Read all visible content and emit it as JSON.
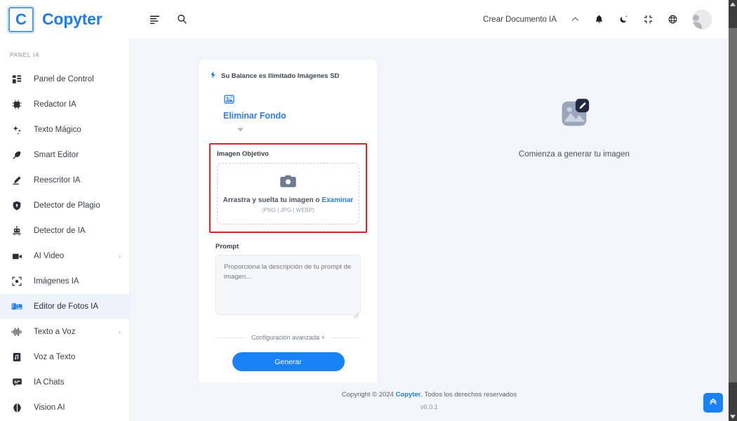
{
  "header": {
    "logo_letter": "C",
    "brand": "Copyter",
    "menu_icon": "menu-icon",
    "search_icon": "search-icon",
    "create_doc_label": "Crear Documento IA",
    "chevron_icon": "chevron-up-icon",
    "bell_icon": "bell-icon",
    "theme_icon": "moon-icon",
    "fullscreen_icon": "compress-icon",
    "language_icon": "globe-icon",
    "avatar_icon": "user-avatar"
  },
  "sidebar": {
    "section_title": "PANEL IA",
    "items": [
      {
        "label": "Panel de Control",
        "icon": "dashboard-icon",
        "active": false,
        "expandable": false
      },
      {
        "label": "Redactor IA",
        "icon": "chip-icon",
        "active": false,
        "expandable": false
      },
      {
        "label": "Texto Mágico",
        "icon": "sparkles-icon",
        "active": false,
        "expandable": false
      },
      {
        "label": "Smart Editor",
        "icon": "feather-icon",
        "active": false,
        "expandable": false
      },
      {
        "label": "Reescritor IA",
        "icon": "pencil-icon",
        "active": false,
        "expandable": false
      },
      {
        "label": "Detector de Plagio",
        "icon": "shield-icon",
        "active": false,
        "expandable": false
      },
      {
        "label": "Detector de IA",
        "icon": "robot-icon",
        "active": false,
        "expandable": false
      },
      {
        "label": "AI Video",
        "icon": "video-icon",
        "active": false,
        "expandable": true
      },
      {
        "label": "Imágenes IA",
        "icon": "image-frame-icon",
        "active": false,
        "expandable": false
      },
      {
        "label": "Editor de Fotos IA",
        "icon": "photo-edit-icon",
        "active": true,
        "expandable": false
      },
      {
        "label": "Texto a Voz",
        "icon": "waveform-icon",
        "active": false,
        "expandable": true
      },
      {
        "label": "Voz a Texto",
        "icon": "audio-file-icon",
        "active": false,
        "expandable": false
      },
      {
        "label": "IA Chats",
        "icon": "chat-icon",
        "active": false,
        "expandable": false
      },
      {
        "label": "Vision AI",
        "icon": "brain-icon",
        "active": false,
        "expandable": false
      }
    ],
    "chevron_glyph": "›"
  },
  "card": {
    "balance_icon": "bolt-icon",
    "balance_text": "Su Balance es Ilimitado Imágenes SD",
    "tool_icon": "image-off-icon",
    "tool_name": "Eliminar Fondo",
    "tool_caret_icon": "caret-down-icon",
    "target_label": "Imagen Objetivo",
    "dropzone_icon": "camera-icon",
    "dropzone_text": "Arrastra y suelta tu imagen o ",
    "dropzone_link": "Examinar",
    "dropzone_formats": "(PNG | JPG | WEBP)",
    "prompt_label": "Prompt",
    "prompt_placeholder": "Proporciona la descripción de tu prompt de imagen...",
    "prompt_value": "",
    "advanced_label": "Configuración avanzada +",
    "generate_label": "Generar",
    "highlight_color": "#ee1c25"
  },
  "preview": {
    "icon": "image-edit-placeholder-icon",
    "text": "Comienza a generar tu imagen"
  },
  "footer": {
    "copyright_prefix": "Copyright © 2024 ",
    "brand": "Copyter",
    "copyright_suffix": ". Todos los derechos reservados",
    "version": "v6.0.1"
  },
  "scroll_top": {
    "icon": "double-chevron-up-icon"
  },
  "colors": {
    "accent": "#1a82f7",
    "brand_blue": "#1a7ef0",
    "bg": "#f2f6fa",
    "highlight": "#ee1c25"
  }
}
